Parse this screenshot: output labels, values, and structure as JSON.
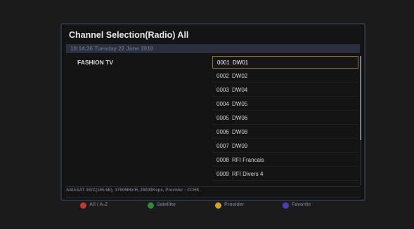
{
  "window": {
    "title": "Channel Selection(Radio) All",
    "datetime": "10:14:36 Tuesday 22 June 2010"
  },
  "preview": {
    "channel_name": "FASHION TV"
  },
  "channels": [
    {
      "number": "0001",
      "name": "DW01",
      "selected": true
    },
    {
      "number": "0002",
      "name": "DW02"
    },
    {
      "number": "0003",
      "name": "DW04"
    },
    {
      "number": "0004",
      "name": "DW05"
    },
    {
      "number": "0005",
      "name": "DW06"
    },
    {
      "number": "0006",
      "name": "DW08"
    },
    {
      "number": "0007",
      "name": "DW09"
    },
    {
      "number": "0008",
      "name": "RFI Francais"
    },
    {
      "number": "0009",
      "name": "RFI Divers 4"
    }
  ],
  "status": {
    "satellite_info": "ASIASAT 3S/C(105.5E),   3760MHz/H,   26000Ksps,   Provider - CCHK"
  },
  "legend": [
    {
      "label": "All / A-Z",
      "color": "#c0392b",
      "icon": "red-button-icon"
    },
    {
      "label": "Satellite",
      "color": "#2e8b3a",
      "icon": "green-button-icon"
    },
    {
      "label": "Provider",
      "color": "#c9a227",
      "icon": "yellow-button-icon"
    },
    {
      "label": "Favorite",
      "color": "#4b3fb8",
      "icon": "blue-button-icon"
    }
  ]
}
